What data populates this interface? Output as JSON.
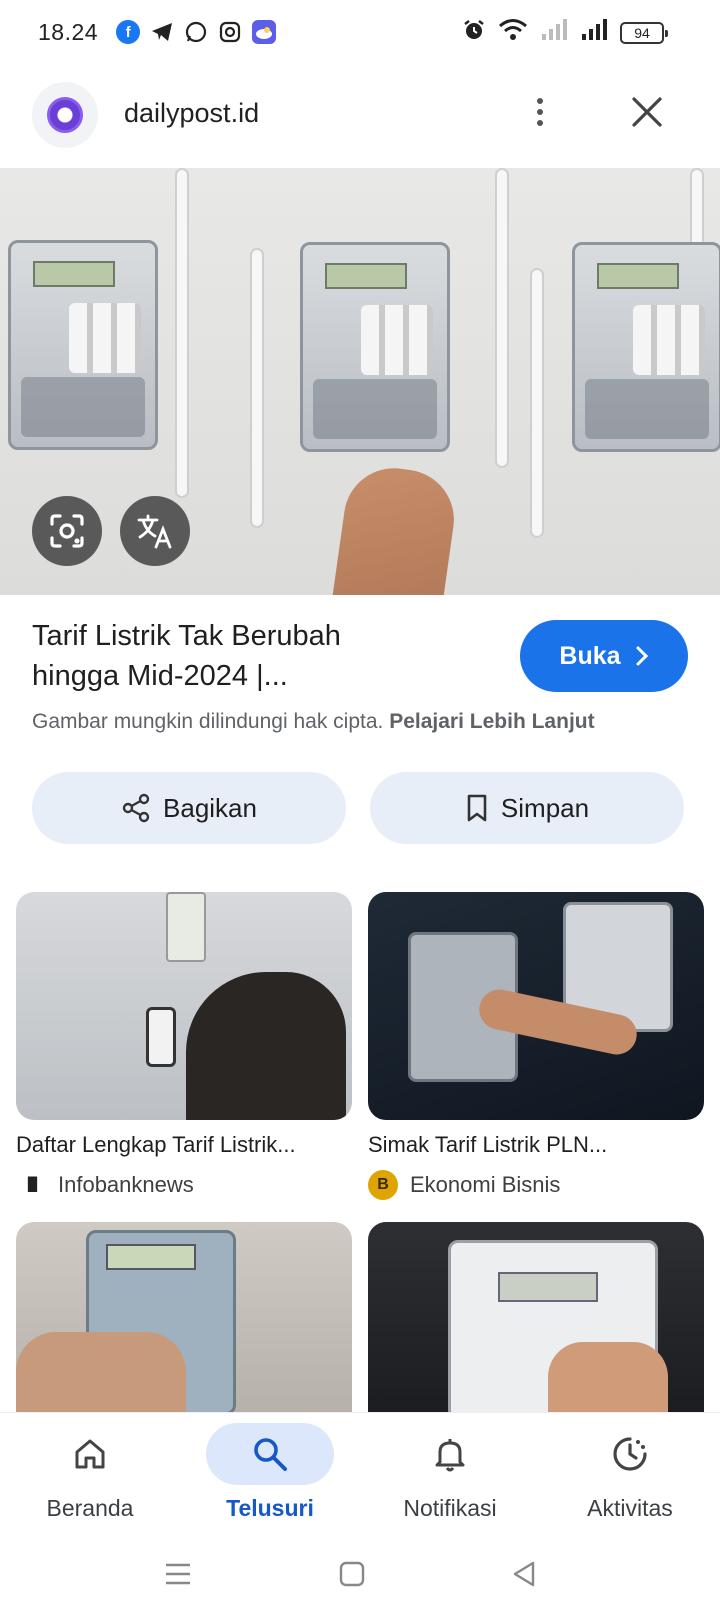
{
  "status_bar": {
    "time": "18.24",
    "battery": "94",
    "app_icons": [
      "facebook-icon",
      "telegram-icon",
      "whatsapp-icon",
      "instagram-icon",
      "weather-icon"
    ]
  },
  "site": {
    "domain": "dailypost.id"
  },
  "result": {
    "title_line1": "Tarif Listrik Tak Berubah",
    "title_line2": "hingga Mid-2024 |...",
    "open_label": "Buka",
    "copyright_text": "Gambar mungkin dilindungi hak cipta.",
    "copyright_link": "Pelajari Lebih Lanjut"
  },
  "actions": {
    "share_label": "Bagikan",
    "save_label": "Simpan"
  },
  "related": [
    {
      "title": "Daftar Lengkap Tarif Listrik...",
      "source": "Infobanknews"
    },
    {
      "title": "Simak Tarif Listrik PLN...",
      "source": "Ekonomi Bisnis"
    },
    {
      "title": "",
      "source": ""
    },
    {
      "title": "",
      "source": ""
    }
  ],
  "bottom_nav": {
    "items": [
      {
        "label": "Beranda",
        "icon": "home-icon"
      },
      {
        "label": "Telusuri",
        "icon": "search-icon"
      },
      {
        "label": "Notifikasi",
        "icon": "bell-icon"
      },
      {
        "label": "Aktivitas",
        "icon": "activity-icon"
      }
    ],
    "active": "Telusuri"
  },
  "colors": {
    "accent": "#1a73e8",
    "pill_bg": "#e8eef8",
    "active_nav": "#dde7fb"
  }
}
